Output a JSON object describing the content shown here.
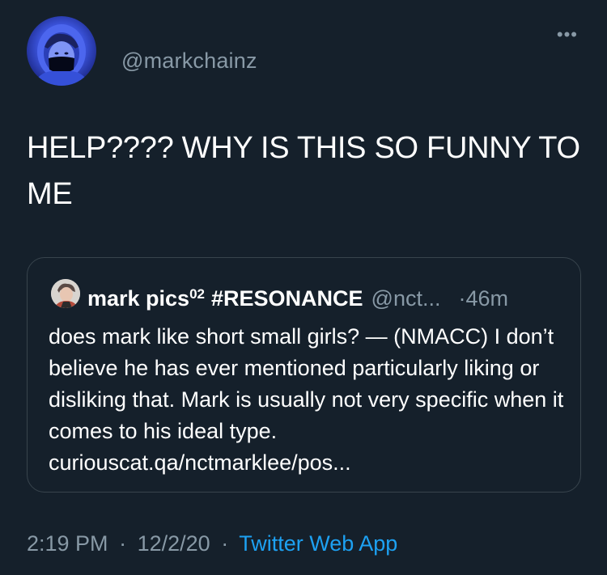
{
  "author": {
    "handle": "@markchainz"
  },
  "menu": {
    "more_label": "•••"
  },
  "tweet": {
    "text": "HELP???? WHY IS THIS SO FUNNY TO ME"
  },
  "quoted": {
    "name": "mark pics",
    "name_superscript": "02",
    "hashtag": "#RESONANCE",
    "handle": "@nct...",
    "separator": "·",
    "time": "46m",
    "text": "does mark like short small girls? — (NMACC) I don’t believe he has ever mentioned particularly liking or disliking that. Mark is usually not very specific when it comes to his ideal type.  curiouscat.qa/nctmarklee/pos..."
  },
  "meta": {
    "time": "2:19 PM",
    "dot1": "·",
    "date": "12/2/20",
    "dot2": "·",
    "source": "Twitter Web App"
  },
  "colors": {
    "background": "#15202b",
    "secondary_text": "#8899a6",
    "link": "#1da1f2",
    "border": "#38444d"
  }
}
